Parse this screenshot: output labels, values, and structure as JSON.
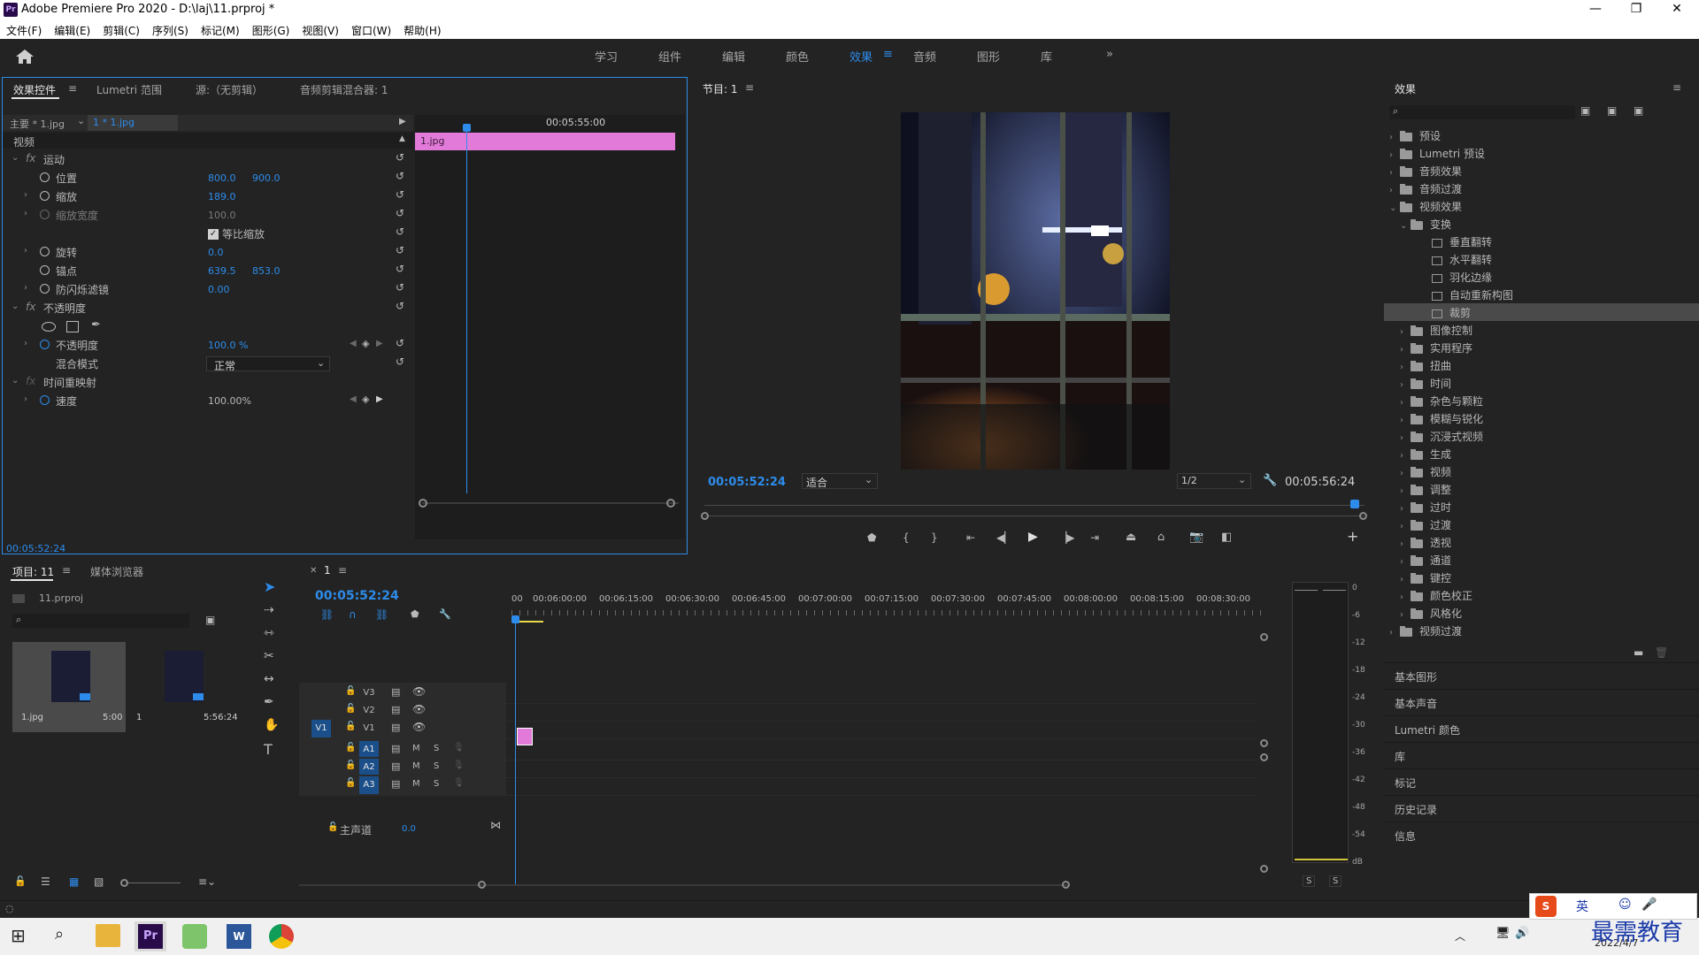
{
  "window": {
    "title": "Adobe Premiere Pro 2020 - D:\\laj\\11.prproj *",
    "logo": "Pr",
    "minimize": "—",
    "maximize": "❐",
    "close": "✕"
  },
  "menu": [
    "文件(F)",
    "编辑(E)",
    "剪辑(C)",
    "序列(S)",
    "标记(M)",
    "图形(G)",
    "视图(V)",
    "窗口(W)",
    "帮助(H)"
  ],
  "workspaces": [
    "学习",
    "组件",
    "编辑",
    "颜色",
    "效果",
    "音频",
    "图形",
    "库"
  ],
  "active_workspace": "效果",
  "effect_controls": {
    "tabs": [
      "效果控件",
      "Lumetri 范围",
      "源:（无剪辑）",
      "音频剪辑混合器: 1"
    ],
    "master_label": "主要 * 1.jpg",
    "clip_label": "1 * 1.jpg",
    "section_video": "视频",
    "timecode_ruler": "00:05:55:00",
    "clip_name": "1.jpg",
    "motion": "运动",
    "position": {
      "label": "位置",
      "x": "800.0",
      "y": "900.0"
    },
    "scale": {
      "label": "缩放",
      "value": "189.0"
    },
    "scale_width": {
      "label": "缩放宽度",
      "value": "100.0"
    },
    "uniform_scale": "等比缩放",
    "rotation": {
      "label": "旋转",
      "value": "0.0"
    },
    "anchor": {
      "label": "锚点",
      "x": "639.5",
      "y": "853.0"
    },
    "anti_flicker": {
      "label": "防闪烁滤镜",
      "value": "0.00"
    },
    "opacity_group": "不透明度",
    "opacity": {
      "label": "不透明度",
      "value": "100.0 %"
    },
    "blend_mode": {
      "label": "混合模式",
      "value": "正常"
    },
    "time_remap": "时间重映射",
    "speed": {
      "label": "速度",
      "value": "100.00%"
    },
    "footer_timecode": "00:05:52:24"
  },
  "program_monitor": {
    "title": "节目: 1",
    "timecode_current": "00:05:52:24",
    "zoom": "适合",
    "resolution": "1/2",
    "timecode_duration": "00:05:56:24"
  },
  "effects_panel": {
    "title": "效果",
    "tree": [
      {
        "label": "预设",
        "depth": 0,
        "open": false,
        "type": "folder"
      },
      {
        "label": "Lumetri 预设",
        "depth": 0,
        "open": false,
        "type": "folder"
      },
      {
        "label": "音频效果",
        "depth": 0,
        "open": false,
        "type": "folder"
      },
      {
        "label": "音频过渡",
        "depth": 0,
        "open": false,
        "type": "folder"
      },
      {
        "label": "视频效果",
        "depth": 0,
        "open": true,
        "type": "folder"
      },
      {
        "label": "变换",
        "depth": 1,
        "open": true,
        "type": "folder"
      },
      {
        "label": "垂直翻转",
        "depth": 2,
        "type": "effect"
      },
      {
        "label": "水平翻转",
        "depth": 2,
        "type": "effect"
      },
      {
        "label": "羽化边缘",
        "depth": 2,
        "type": "effect"
      },
      {
        "label": "自动重新构图",
        "depth": 2,
        "type": "effect"
      },
      {
        "label": "裁剪",
        "depth": 2,
        "type": "effect",
        "selected": true
      },
      {
        "label": "图像控制",
        "depth": 1,
        "open": false,
        "type": "folder"
      },
      {
        "label": "实用程序",
        "depth": 1,
        "open": false,
        "type": "folder"
      },
      {
        "label": "扭曲",
        "depth": 1,
        "open": false,
        "type": "folder"
      },
      {
        "label": "时间",
        "depth": 1,
        "open": false,
        "type": "folder"
      },
      {
        "label": "杂色与颗粒",
        "depth": 1,
        "open": false,
        "type": "folder"
      },
      {
        "label": "模糊与锐化",
        "depth": 1,
        "open": false,
        "type": "folder"
      },
      {
        "label": "沉浸式视频",
        "depth": 1,
        "open": false,
        "type": "folder"
      },
      {
        "label": "生成",
        "depth": 1,
        "open": false,
        "type": "folder"
      },
      {
        "label": "视频",
        "depth": 1,
        "open": false,
        "type": "folder"
      },
      {
        "label": "调整",
        "depth": 1,
        "open": false,
        "type": "folder"
      },
      {
        "label": "过时",
        "depth": 1,
        "open": false,
        "type": "folder"
      },
      {
        "label": "过渡",
        "depth": 1,
        "open": false,
        "type": "folder"
      },
      {
        "label": "透视",
        "depth": 1,
        "open": false,
        "type": "folder"
      },
      {
        "label": "通道",
        "depth": 1,
        "open": false,
        "type": "folder"
      },
      {
        "label": "键控",
        "depth": 1,
        "open": false,
        "type": "folder"
      },
      {
        "label": "颜色校正",
        "depth": 1,
        "open": false,
        "type": "folder"
      },
      {
        "label": "风格化",
        "depth": 1,
        "open": false,
        "type": "folder"
      },
      {
        "label": "视频过渡",
        "depth": 0,
        "open": false,
        "type": "folder"
      }
    ],
    "collapsed_panels": [
      "基本图形",
      "基本声音",
      "Lumetri 颜色",
      "库",
      "标记",
      "历史记录",
      "信息"
    ]
  },
  "project_panel": {
    "tabs": [
      "项目: 11",
      "媒体浏览器"
    ],
    "project_file": "11.prproj",
    "items": [
      {
        "name": "1.jpg",
        "duration": "5:00"
      },
      {
        "name": "1",
        "duration": "5:56:24"
      }
    ]
  },
  "timeline": {
    "tab": "1",
    "timecode": "00:05:52:24",
    "ruler": [
      "00",
      "00:06:00:00",
      "00:06:15:00",
      "00:06:30:00",
      "00:06:45:00",
      "00:07:00:00",
      "00:07:15:00",
      "00:07:30:00",
      "00:07:45:00",
      "00:08:00:00",
      "00:08:15:00",
      "00:08:30:00"
    ],
    "video_tracks": [
      "V3",
      "V2",
      "V1"
    ],
    "audio_tracks": [
      "A1",
      "A2",
      "A3"
    ],
    "source_patch": "V1",
    "mute": "M",
    "solo": "S",
    "master_label": "主声道",
    "master_value": "0.0"
  },
  "audio_meter": {
    "scale": [
      "0",
      "-6",
      "-12",
      "-18",
      "-24",
      "-30",
      "-36",
      "-42",
      "-48",
      "-54",
      "dB"
    ],
    "solo_left": "S",
    "solo_right": "S"
  },
  "tray": {
    "ime": "英",
    "watermark": "最需教育",
    "date": "2022/4/7"
  },
  "colors": {
    "accent": "#2d8ceb",
    "clip_pink": "#e27ad9",
    "panel_bg": "#232323",
    "dark_bg": "#1d1d1d"
  }
}
